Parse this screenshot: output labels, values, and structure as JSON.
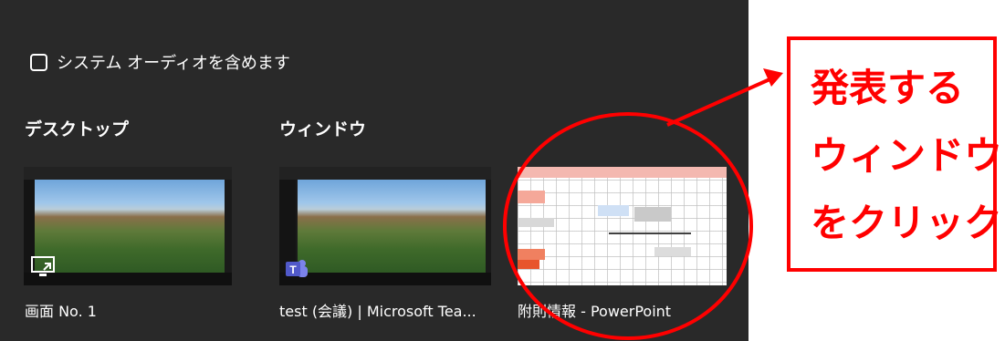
{
  "audio_option": {
    "label": "システム オーディオを含めます",
    "checked": false
  },
  "desktop_section": {
    "title": "デスクトップ",
    "items": [
      {
        "label": "画面 No. 1",
        "icon": "screen-share-icon"
      }
    ]
  },
  "window_section": {
    "title": "ウィンドウ",
    "items": [
      {
        "label": "test (会議) | Microsoft Tea...",
        "icon": "teams-icon"
      },
      {
        "label": "附則情報 - PowerPoint",
        "icon": "powerpoint-icon"
      }
    ]
  },
  "annotation": {
    "lines": [
      "発表する",
      "ウィンドウ",
      "をクリック"
    ],
    "color": "#ff0000"
  },
  "colors": {
    "panel_bg": "#292929",
    "text": "#ffffff",
    "accent": "#ff0000"
  }
}
